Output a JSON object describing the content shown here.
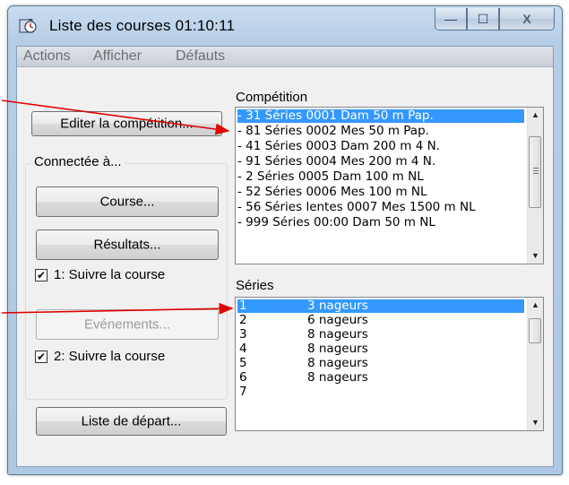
{
  "window": {
    "title": "Liste des courses  01:10:11",
    "icon": "stopwatch-app-icon",
    "controls": {
      "minimize": "—",
      "maximize": "☐",
      "close": "X"
    }
  },
  "menu": [
    "Actions",
    "Afficher",
    "Défauts"
  ],
  "left": {
    "edit_button": "Editer la compétition...",
    "group_title": "Connectée à...",
    "course_button": "Course...",
    "results_button": "Résultats...",
    "check1": "1: Suivre la course",
    "events_button": "Evénements...",
    "check2": "2: Suivre la course",
    "start_list_button": "Liste de départ..."
  },
  "competition": {
    "label": "Compétition",
    "items": [
      "- 31 Séries 0001 Dam 50 m Pap.",
      "- 81 Séries 0002 Mes 50 m Pap.",
      "- 41 Séries 0003 Dam 200 m 4 N.",
      "- 91 Séries 0004 Mes 200 m 4 N.",
      "- 2 Séries 0005 Dam 100 m NL",
      "- 52 Séries 0006 Mes 100 m NL",
      "- 56 Séries lentes 0007 Mes 1500 m NL",
      "- 999 Séries 00:00 Dam 50 m NL"
    ],
    "selected_index": 0
  },
  "series": {
    "label": "Séries",
    "items": [
      {
        "num": "1",
        "text": "3 nageurs"
      },
      {
        "num": "2",
        "text": "6 nageurs"
      },
      {
        "num": "3",
        "text": "8 nageurs"
      },
      {
        "num": "4",
        "text": "8 nageurs"
      },
      {
        "num": "5",
        "text": "8 nageurs"
      },
      {
        "num": "6",
        "text": "8 nageurs"
      },
      {
        "num": "7",
        "text": ""
      }
    ],
    "selected_index": 0
  },
  "colors": {
    "selection": "#3399ff",
    "annotation_arrow": "#e00000"
  }
}
